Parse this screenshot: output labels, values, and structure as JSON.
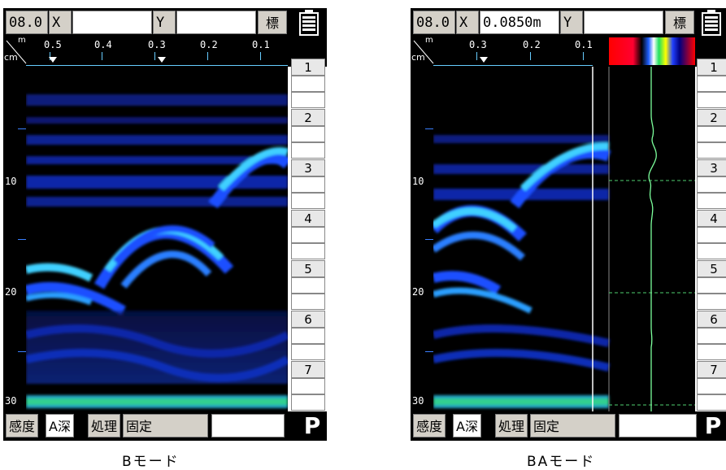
{
  "b_mode": {
    "caption": "Bモード",
    "header": {
      "scale": "08.0",
      "x_label": "X",
      "x_value": "",
      "y_label": "Y",
      "y_value": "",
      "standard_button": "標"
    },
    "scale": {
      "unit_m": "m",
      "unit_cm": "cm",
      "ticks": [
        "0.5",
        "0.4",
        "0.3",
        "0.2",
        "0.1"
      ]
    },
    "depth_labels": [
      "10",
      "20",
      "30"
    ],
    "layers": [
      "1",
      "2",
      "3",
      "4",
      "5",
      "6",
      "7"
    ],
    "footer": {
      "sensitivity": "感度",
      "depth_mode": "A深",
      "processing": "処理",
      "fixed": "固定",
      "p_button": "P"
    }
  },
  "ba_mode": {
    "caption": "BAモード",
    "header": {
      "scale": "08.0",
      "x_label": "X",
      "x_value": "0.0850m",
      "y_label": "Y",
      "y_value": "",
      "standard_button": "標"
    },
    "scale": {
      "unit_m": "m",
      "unit_cm": "cm",
      "ticks": [
        "0.3",
        "0.2",
        "0.1"
      ]
    },
    "depth_labels": [
      "10",
      "20",
      "30"
    ],
    "layers": [
      "1",
      "2",
      "3",
      "4",
      "5",
      "6",
      "7"
    ],
    "footer": {
      "sensitivity": "感度",
      "depth_mode": "A深",
      "processing": "処理",
      "fixed": "固定",
      "p_button": "P"
    }
  },
  "colors": {
    "radar_bg": "#000000",
    "echo_dark": "#0a1a8a",
    "echo_mid": "#1a4fff",
    "echo_bright": "#3fd0ff",
    "surface": "#30d090",
    "waveform": "#7cff9c",
    "accent_tick": "#66ccff"
  }
}
